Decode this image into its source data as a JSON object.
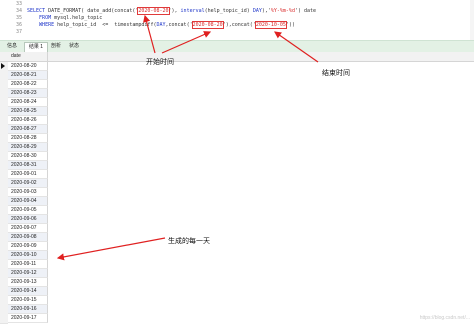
{
  "editor": {
    "lines": [
      {
        "num": "33",
        "text": ""
      },
      {
        "num": "34",
        "text": "SELECT DATE_FORMAT( date_add(concat('2020-08-20'), interval(help_topic_id) DAY),'%Y-%m-%d') date"
      },
      {
        "num": "35",
        "text": "    FROM mysql.help_topic"
      },
      {
        "num": "36",
        "text": "    WHERE help_topic_id  <=  timestampdiff(DAY,concat('2020-08-20'),concat('2020-10-05'))"
      },
      {
        "num": "37",
        "text": ""
      }
    ],
    "highlight_start": "2020-08-20",
    "highlight_end": "2020-10-05"
  },
  "tabs": [
    "信息",
    "结果 1",
    "剖析",
    "状态"
  ],
  "active_tab": 1,
  "grid": {
    "column": "date",
    "rows": [
      "2020-08-20",
      "2020-08-21",
      "2020-08-22",
      "2020-08-23",
      "2020-08-24",
      "2020-08-25",
      "2020-08-26",
      "2020-08-27",
      "2020-08-28",
      "2020-08-29",
      "2020-08-30",
      "2020-08-31",
      "2020-09-01",
      "2020-09-02",
      "2020-09-03",
      "2020-09-04",
      "2020-09-05",
      "2020-09-06",
      "2020-09-07",
      "2020-09-08",
      "2020-09-09",
      "2020-09-10",
      "2020-09-11",
      "2020-09-12",
      "2020-09-13",
      "2020-09-14",
      "2020-09-15",
      "2020-09-16",
      "2020-09-17"
    ]
  },
  "annotations": {
    "start": "开始时间",
    "end": "结束时间",
    "generated": "生成的每一天"
  },
  "watermark": "https://blog.csdn.net/..."
}
